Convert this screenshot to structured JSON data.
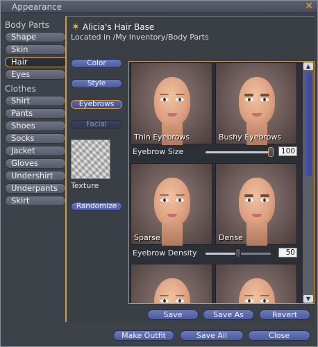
{
  "window": {
    "title": "Appearance"
  },
  "categories": {
    "body_header": "Body Parts",
    "body_items": [
      {
        "label": "Shape"
      },
      {
        "label": "Skin"
      },
      {
        "label": "Hair",
        "selected": true
      },
      {
        "label": "Eyes"
      }
    ],
    "clothes_header": "Clothes",
    "clothes_items": [
      {
        "label": "Shirt"
      },
      {
        "label": "Pants"
      },
      {
        "label": "Shoes"
      },
      {
        "label": "Socks"
      },
      {
        "label": "Jacket"
      },
      {
        "label": "Gloves"
      },
      {
        "label": "Undershirt"
      },
      {
        "label": "Underpants"
      },
      {
        "label": "Skirt"
      }
    ]
  },
  "asset": {
    "name": "Alicia's Hair Base",
    "location": "Located in /My Inventory/Body Parts",
    "icon": "body-part-icon"
  },
  "subcategories": [
    {
      "label": "Color"
    },
    {
      "label": "Style"
    },
    {
      "label": "Eyebrows",
      "selected": true
    },
    {
      "label": "Facial",
      "disabled": true
    }
  ],
  "texture": {
    "label": "Texture"
  },
  "randomize_label": "Randomize",
  "params": [
    {
      "min_label": "Thin Eyebrows",
      "max_label": "Bushy Eyebrows",
      "name": "Eyebrow Size",
      "value": "100",
      "fraction": 1.0
    },
    {
      "min_label": "Sparse",
      "max_label": "Dense",
      "name": "Eyebrow Density",
      "value": "50",
      "fraction": 0.5
    }
  ],
  "footer": {
    "save": "Save",
    "save_as": "Save As",
    "revert": "Revert",
    "make_outfit": "Make Outfit",
    "save_all": "Save All",
    "close": "Close"
  },
  "colors": {
    "accent": "#d39a3a",
    "button": "#5a68b0",
    "panel": "#3d4148"
  }
}
